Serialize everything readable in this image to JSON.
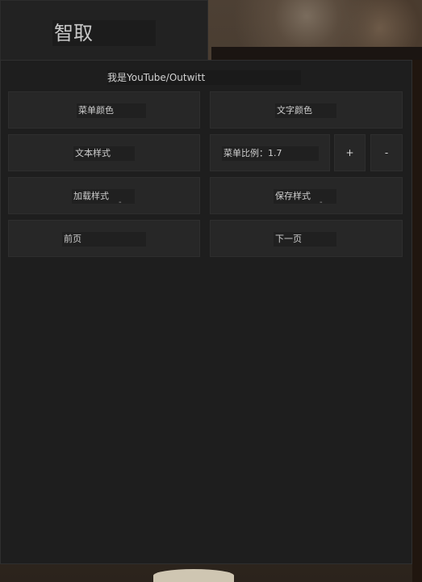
{
  "title": "智取",
  "header": "我是YouTube/Outwitt",
  "buttons": {
    "menu_color": "菜单颜色",
    "text_color": "文字颜色",
    "text_style": "文本样式",
    "menu_scale": "菜单比例：1.7",
    "plus": "+",
    "minus": "-",
    "load_style": "加载样式",
    "save_style": "保存样式",
    "prev_page": "前页",
    "next_page": "下一页"
  },
  "small_marks": {
    "load_style": "-",
    "save_style": "-"
  }
}
